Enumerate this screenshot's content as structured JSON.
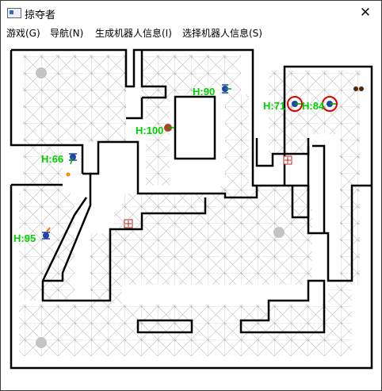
{
  "window": {
    "title": "掠夺者",
    "close_glyph": "✕"
  },
  "menu": [
    {
      "label": "游戏(G)"
    },
    {
      "label": "导航(N)"
    },
    {
      "label": "生成机器人信息(I)"
    },
    {
      "label": "选择机器人信息(S)"
    }
  ],
  "bots": [
    {
      "health_label": "H:90",
      "selected": false,
      "color": "#2244aa"
    },
    {
      "health_label": "H:100",
      "selected": false,
      "color": "#aa4422"
    },
    {
      "health_label": "H:66",
      "selected": false,
      "color": "#2244aa"
    },
    {
      "health_label": "H:95",
      "selected": false,
      "color": "#2244aa"
    },
    {
      "health_label": "H:71",
      "selected": true,
      "color": "#2244aa"
    },
    {
      "health_label": "H:84",
      "selected": true,
      "color": "#2244aa"
    }
  ],
  "colors": {
    "health_text": "#00d000",
    "walls": "#000000",
    "graph": "#b8b8b8",
    "selection_ring": "#e00000"
  },
  "items": [
    {
      "type": "health-pack-icon"
    },
    {
      "type": "health-pack-icon"
    },
    {
      "type": "spawn-point-icon"
    },
    {
      "type": "spawn-point-icon"
    },
    {
      "type": "spawn-point-icon"
    },
    {
      "type": "rocket-launcher-icon"
    }
  ]
}
